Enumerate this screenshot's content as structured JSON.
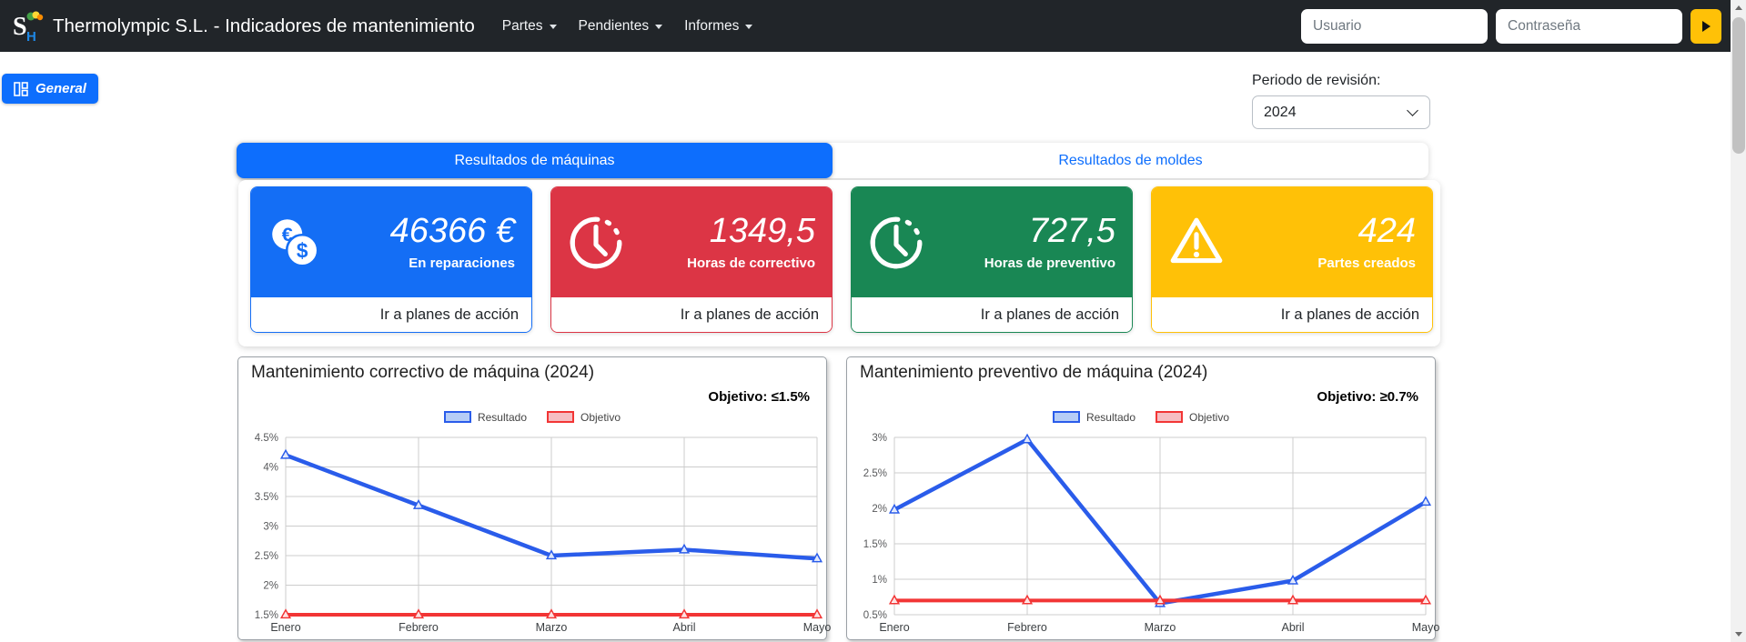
{
  "colors": {
    "primary": "#0d6efd",
    "navbar_bg": "#212529",
    "warning": "#ffc107"
  },
  "navbar": {
    "brand": "Thermolympic S.L. - Indicadores de mantenimiento",
    "menu": [
      {
        "label": "Partes"
      },
      {
        "label": "Pendientes"
      },
      {
        "label": "Informes"
      }
    ],
    "username_placeholder": "Usuario",
    "password_placeholder": "Contraseña"
  },
  "general_button": {
    "label": "General"
  },
  "period": {
    "label": "Periodo de revisión:",
    "selected": "2024"
  },
  "tabs": [
    {
      "label": "Resultados de máquinas",
      "active": true
    },
    {
      "label": "Resultados de moldes",
      "active": false
    }
  ],
  "cards": [
    {
      "value": "46366 €",
      "label": "En reparaciones",
      "footer": "Ir a planes de acción",
      "color": "#146ef5",
      "icon": "euro-dollar-coins-icon"
    },
    {
      "value": "1349,5",
      "label": "Horas de correctivo",
      "footer": "Ir a planes de acción",
      "color": "#dc3545",
      "icon": "clock-icon"
    },
    {
      "value": "727,5",
      "label": "Horas de preventivo",
      "footer": "Ir a planes de acción",
      "color": "#198754",
      "icon": "clock-icon"
    },
    {
      "value": "424",
      "label": "Partes creados",
      "footer": "Ir a planes de acción",
      "color": "#ffc107",
      "icon": "warning-triangle-icon"
    }
  ],
  "chart_data": [
    {
      "type": "line",
      "title": "Mantenimiento correctivo de máquina (2024)",
      "objective_label": "Objetivo: ≤1.5%",
      "categories": [
        "Enero",
        "Febrero",
        "Marzo",
        "Abril",
        "Mayo"
      ],
      "series": [
        {
          "name": "Resultado",
          "color": "#2a5cea",
          "fill": "#b6cdf6",
          "values": [
            4.2,
            3.35,
            2.5,
            2.6,
            2.45
          ]
        },
        {
          "name": "Objetivo",
          "color": "#f23535",
          "fill": "#f6bec2",
          "values": [
            1.5,
            1.5,
            1.5,
            1.5,
            1.5
          ]
        }
      ],
      "ylim": [
        1.5,
        4.5
      ],
      "yticks": [
        4.5,
        4,
        3.5,
        3,
        2.5,
        2,
        1.5
      ],
      "ytick_labels": [
        "4.5%",
        "4%",
        "3.5%",
        "3%",
        "2.5%",
        "2%",
        "1.5%"
      ],
      "grid": true,
      "legend_position": "top-center",
      "marker": "triangle"
    },
    {
      "type": "line",
      "title": "Mantenimiento preventivo de máquina (2024)",
      "objective_label": "Objetivo: ≥0.7%",
      "categories": [
        "Enero",
        "Febrero",
        "Marzo",
        "Abril",
        "Mayo"
      ],
      "series": [
        {
          "name": "Resultado",
          "color": "#2a5cea",
          "fill": "#b6cdf6",
          "values": [
            1.98,
            2.97,
            0.66,
            0.98,
            2.09
          ]
        },
        {
          "name": "Objetivo",
          "color": "#f23535",
          "fill": "#f6bec2",
          "values": [
            0.7,
            0.7,
            0.7,
            0.7,
            0.7
          ]
        }
      ],
      "ylim": [
        0.5,
        3
      ],
      "yticks": [
        3,
        2.5,
        2,
        1.5,
        1,
        0.5
      ],
      "ytick_labels": [
        "3%",
        "2.5%",
        "2%",
        "1.5%",
        "1%",
        "0.5%"
      ],
      "grid": true,
      "legend_position": "top-center",
      "marker": "triangle"
    }
  ]
}
